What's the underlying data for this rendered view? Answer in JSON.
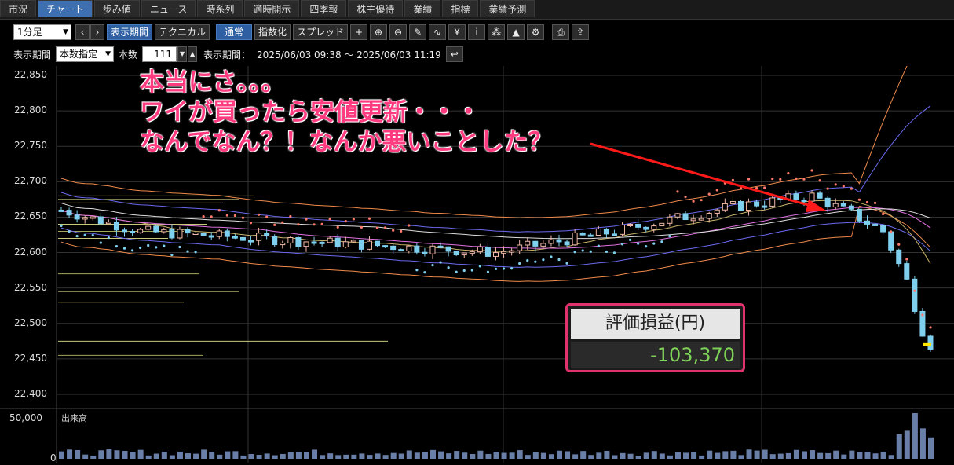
{
  "tabs": [
    "市況",
    "チャート",
    "歩み値",
    "ニュース",
    "時系列",
    "適時開示",
    "四季報",
    "株主優待",
    "業績",
    "指標",
    "業績予測"
  ],
  "toolbar": {
    "interval": "1分足",
    "display_period_btn": "表示期間",
    "technical_btn": "テクニカル",
    "normal_btn": "通常",
    "index_btn": "指数化",
    "spread_btn": "スプレッド",
    "yen_icon": "¥",
    "info_icon": "i"
  },
  "period_bar": {
    "label": "表示期間",
    "mode": "本数指定",
    "count_label": "本数",
    "count_value": "111",
    "range_label": "表示期間：",
    "range_value": "2025/06/03 09:38 ～ 2025/06/03 11:19"
  },
  "chart_data": {
    "type": "candlestick",
    "y_ticks": [
      "22,850",
      "22,800",
      "22,750",
      "22,700",
      "22,650",
      "22,600",
      "22,550",
      "22,500",
      "22,450",
      "22,400"
    ],
    "ylim": [
      22400,
      22850
    ],
    "volume_label": "出来高",
    "volume_ticks": [
      "50,000",
      "0"
    ],
    "last_price": 22470
  },
  "annotation": {
    "line1": "本当にさ。。。",
    "line2": "ワイが買ったら安値更新・・・",
    "line3": "なんでなん？！なんか悪いことした？"
  },
  "pnl_panel": {
    "title": "評価損益(円)",
    "value": "-103,370"
  },
  "colors": {
    "tab_active": "#3e6fb0",
    "candle_up": "#f1b9a7",
    "candle_down": "#7fd0ef",
    "annotation": "#ff3b7f",
    "pnl_value": "#7fd357",
    "arrow": "#ff1a1a"
  }
}
